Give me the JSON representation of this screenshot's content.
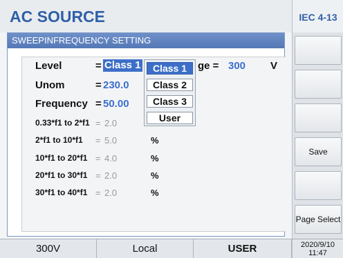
{
  "header": {
    "title": "AC SOURCE"
  },
  "panel": {
    "title": "SWEEPINFREQUENCY SETTING",
    "level": {
      "label": "Level",
      "eq": "=",
      "value": "Class 1",
      "voltage_label_partial": "ge =",
      "voltage_value": "300",
      "voltage_unit": "V"
    },
    "unom": {
      "label": "Unom",
      "eq": "=",
      "value": "230.0"
    },
    "frequency": {
      "label": "Frequency",
      "eq": "=",
      "value": "50.00"
    },
    "rows": [
      {
        "label": "0.33*f1 to 2*f1",
        "eq": "=",
        "value": "2.0",
        "unit": ""
      },
      {
        "label": "2*f1 to 10*f1",
        "eq": "=",
        "value": "5.0",
        "unit": "%"
      },
      {
        "label": "10*f1 to 20*f1",
        "eq": "=",
        "value": "4.0",
        "unit": "%"
      },
      {
        "label": "20*f1 to 30*f1",
        "eq": "=",
        "value": "2.0",
        "unit": "%"
      },
      {
        "label": "30*f1 to 40*f1",
        "eq": "=",
        "value": "2.0",
        "unit": "%"
      }
    ]
  },
  "dropdown": {
    "options": [
      "Class 1",
      "Class 2",
      "Class 3",
      "User"
    ],
    "selected": "Class 1"
  },
  "sidebar": {
    "header": "IEC 4-13",
    "buttons": [
      "",
      "",
      "",
      "Save",
      "",
      "Page Select"
    ]
  },
  "status": {
    "voltage": "300V",
    "mode": "Local",
    "user": "USER",
    "date": "2020/9/10",
    "time": "11:47"
  }
}
